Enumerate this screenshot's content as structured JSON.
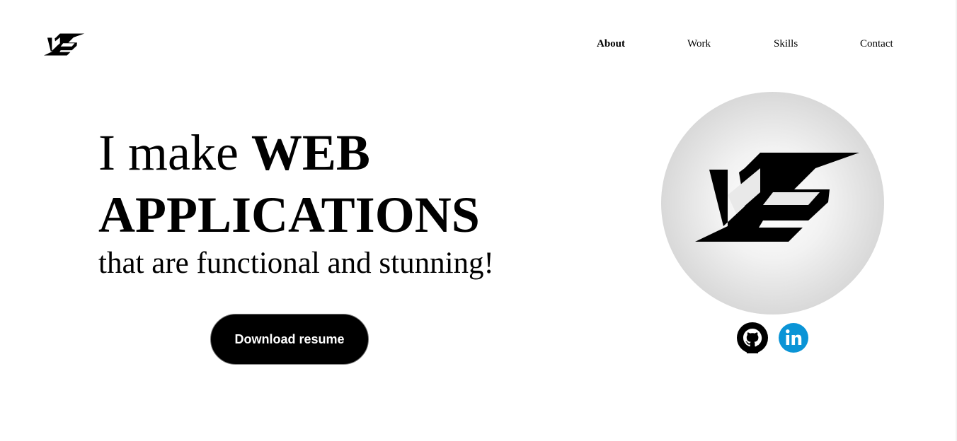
{
  "header": {
    "logo_icon": "ks-logo-icon",
    "nav": [
      {
        "label": "About",
        "active": true
      },
      {
        "label": "Work",
        "active": false
      },
      {
        "label": "Skills",
        "active": false
      },
      {
        "label": "Contact",
        "active": false
      }
    ]
  },
  "hero": {
    "intro": "I make ",
    "highlight_1": "WEB",
    "highlight_2": "APPLICATIONS",
    "subtitle": "that are functional and stunning!",
    "cta_label": "Download resume"
  },
  "profile": {
    "avatar_icon": "ks-logo-icon",
    "social": [
      {
        "name": "github-icon",
        "color": "#000000"
      },
      {
        "name": "linkedin-icon",
        "color": "#0a94d6"
      }
    ]
  },
  "colors": {
    "background": "#ffffff",
    "text": "#000000",
    "button_bg": "#000000",
    "button_text": "#ffffff",
    "linkedin": "#0a94d6"
  }
}
